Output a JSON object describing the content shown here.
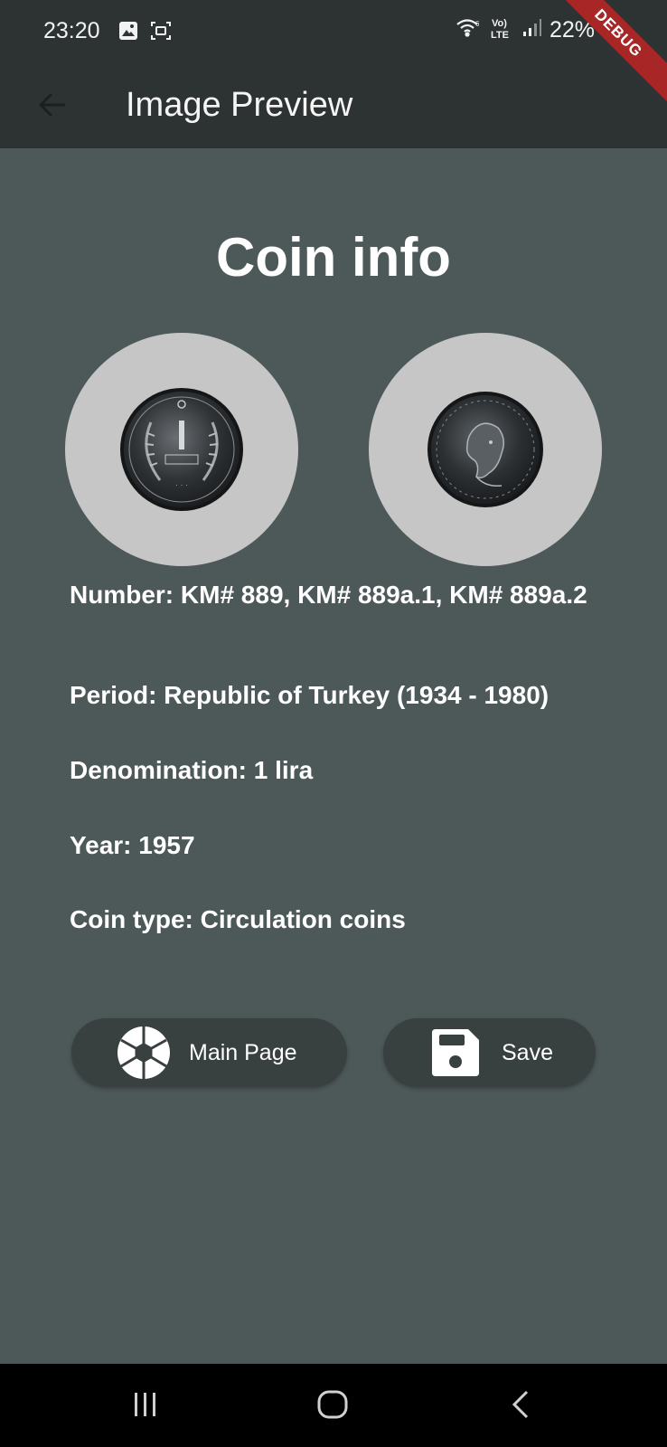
{
  "status_bar": {
    "time": "23:20",
    "battery": "22%",
    "icons": [
      "gallery-icon",
      "screenshot-icon",
      "wifi-icon",
      "volte-icon",
      "signal-icon"
    ]
  },
  "app_bar": {
    "title": "Image Preview",
    "back_icon": "arrow-back-icon",
    "debug_label": "DEBUG"
  },
  "page": {
    "heading": "Coin info",
    "coin_images": [
      "coin-reverse-image",
      "coin-obverse-image"
    ],
    "info": {
      "number": "Number: KM# 889, KM# 889a.1, KM# 889a.2",
      "period": "Period: Republic of Turkey (1934 - 1980)",
      "denomination": "Denomination: 1 lira",
      "year": "Year: 1957",
      "coin_type": "Coin type: Circulation coins"
    }
  },
  "actions": {
    "main_page": {
      "label": "Main Page",
      "icon": "camera-shutter-icon"
    },
    "save": {
      "label": "Save",
      "icon": "save-icon"
    }
  },
  "nav_bar": {
    "icons": [
      "recent-apps-icon",
      "home-icon",
      "back-icon"
    ]
  },
  "colors": {
    "background": "#4d5858",
    "app_bar": "#2d3333",
    "button": "#384040",
    "debug_banner": "#a82626"
  }
}
